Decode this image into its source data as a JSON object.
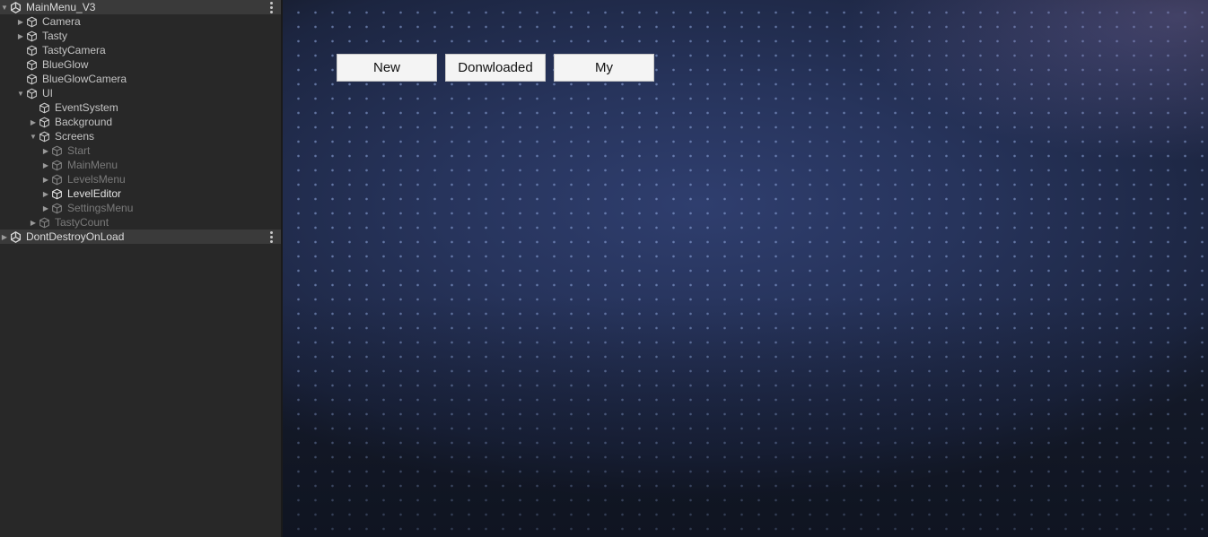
{
  "hierarchy": {
    "scene": "MainMenu_V3",
    "items": [
      {
        "label": "Camera"
      },
      {
        "label": "Tasty"
      },
      {
        "label": "TastyCamera"
      },
      {
        "label": "BlueGlow"
      },
      {
        "label": "BlueGlowCamera"
      },
      {
        "label": "UI"
      },
      {
        "label": "EventSystem"
      },
      {
        "label": "Background"
      },
      {
        "label": "Screens"
      },
      {
        "label": "Start"
      },
      {
        "label": "MainMenu"
      },
      {
        "label": "LevelsMenu"
      },
      {
        "label": "LevelEditor"
      },
      {
        "label": "SettingsMenu"
      },
      {
        "label": "TastyCount"
      }
    ],
    "dont_destroy": "DontDestroyOnLoad"
  },
  "game": {
    "buttons": [
      {
        "label": "New"
      },
      {
        "label": "Donwloaded"
      },
      {
        "label": "My"
      }
    ]
  },
  "colors": {
    "panel_bg": "#282828",
    "scene_row_bg": "#3a3a3a",
    "button_bg": "#f4f4f4",
    "game_bg": "#27345c"
  }
}
